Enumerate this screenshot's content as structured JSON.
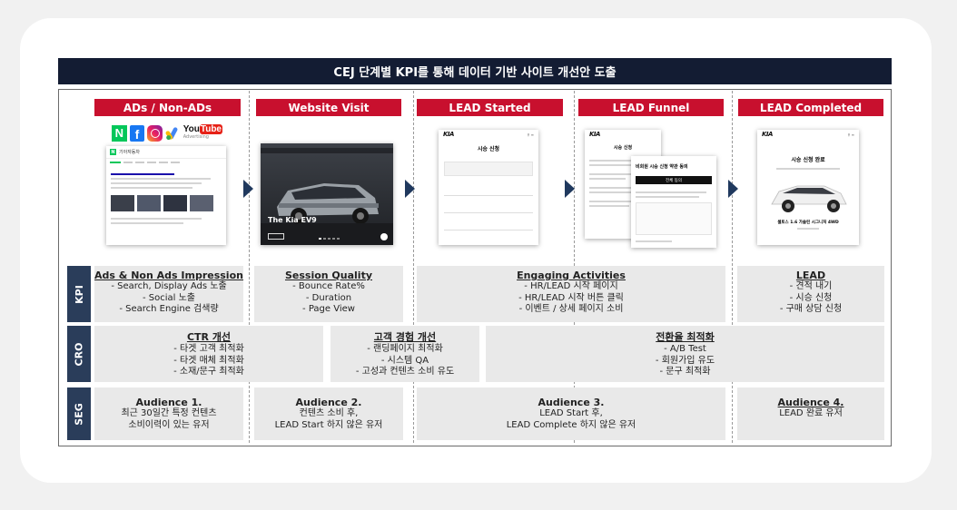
{
  "banner": {
    "title": "CEJ 단계별 KPI를 통해 데이터 기반 사이트 개선안 도출"
  },
  "stages": [
    {
      "label": "ADs / Non-ADs"
    },
    {
      "label": "Website Visit"
    },
    {
      "label": "LEAD Started"
    },
    {
      "label": "LEAD Funnel"
    },
    {
      "label": "LEAD Completed"
    }
  ],
  "colors": {
    "banner": "#131c33",
    "stage_red": "#c8102e",
    "row_label": "#2a3d5a",
    "box_gray": "#e9e9e9",
    "arrow": "#20395e"
  },
  "ads": {
    "logos": [
      "N",
      "f",
      "instagram-icon",
      "google-ads-icon",
      "YouTube"
    ],
    "youtube_top": "You",
    "youtube_tube": "Tube",
    "youtube_sub": "Advertising",
    "search_query": "기아자동차"
  },
  "visit": {
    "caption": "The Kia EV9"
  },
  "lead_started": {
    "logo": "KIA",
    "title": "시승 신청"
  },
  "lead_funnel": {
    "logo": "KIA",
    "title": "시승 신청",
    "popup_title": "비회원 시승 신청 약관 동의",
    "popup_button": "전체 동의"
  },
  "lead_completed": {
    "logo": "KIA",
    "title": "시승 신청 완료",
    "car_name": "셀토스 1.6 가솔린 시그니처 4WD"
  },
  "rows": {
    "kpi": {
      "label": "KPI",
      "cells": [
        {
          "title": "Ads & Non Ads Impression",
          "lines": [
            "- Search, Display Ads 노출",
            "- Social 노출",
            "- Search Engine 검색량"
          ]
        },
        {
          "title": "Session Quality",
          "lines": [
            "- Bounce Rate%",
            "- Duration",
            "- Page View"
          ]
        },
        {
          "title": "Engaging Activities",
          "lines": [
            "- HR/LEAD 시작 페이지",
            "- HR/LEAD 시작 버튼 클릭",
            "- 이벤트 / 상세 페이지 소비"
          ]
        },
        {
          "title": "LEAD",
          "lines": [
            "- 견적 내기",
            "- 시승 신청",
            "- 구매 상담 신청"
          ]
        }
      ]
    },
    "cro": {
      "label": "CRO",
      "cells": [
        {
          "title": "CTR 개선",
          "lines": [
            "- 타겟 고객 최적화",
            "- 타겟 매체 최적화",
            "- 소재/문구 최적화"
          ]
        },
        {
          "title": "고객 경험 개선",
          "lines": [
            "- 랜딩페이지 최적화",
            "- 시스템 QA",
            "- 고성과 컨텐츠 소비 유도"
          ]
        },
        {
          "title": "전환율 최적화",
          "lines": [
            "- A/B Test",
            "- 회원가입 유도",
            "- 문구 최적화"
          ]
        }
      ]
    },
    "seg": {
      "label": "SEG",
      "cells": [
        {
          "title": "Audience 1.",
          "lines": [
            "최근 30일간 특정 컨텐츠",
            "소비이력이 있는 유저"
          ]
        },
        {
          "title": "Audience 2.",
          "lines": [
            "컨텐츠 소비 후,",
            "LEAD Start 하지 않은 유저"
          ]
        },
        {
          "title": "Audience 3.",
          "lines": [
            "LEAD Start 후,",
            "LEAD Complete 하지 않은 유저"
          ]
        },
        {
          "title": "Audience 4.",
          "lines": [
            "LEAD 완료 유저"
          ]
        }
      ]
    }
  }
}
